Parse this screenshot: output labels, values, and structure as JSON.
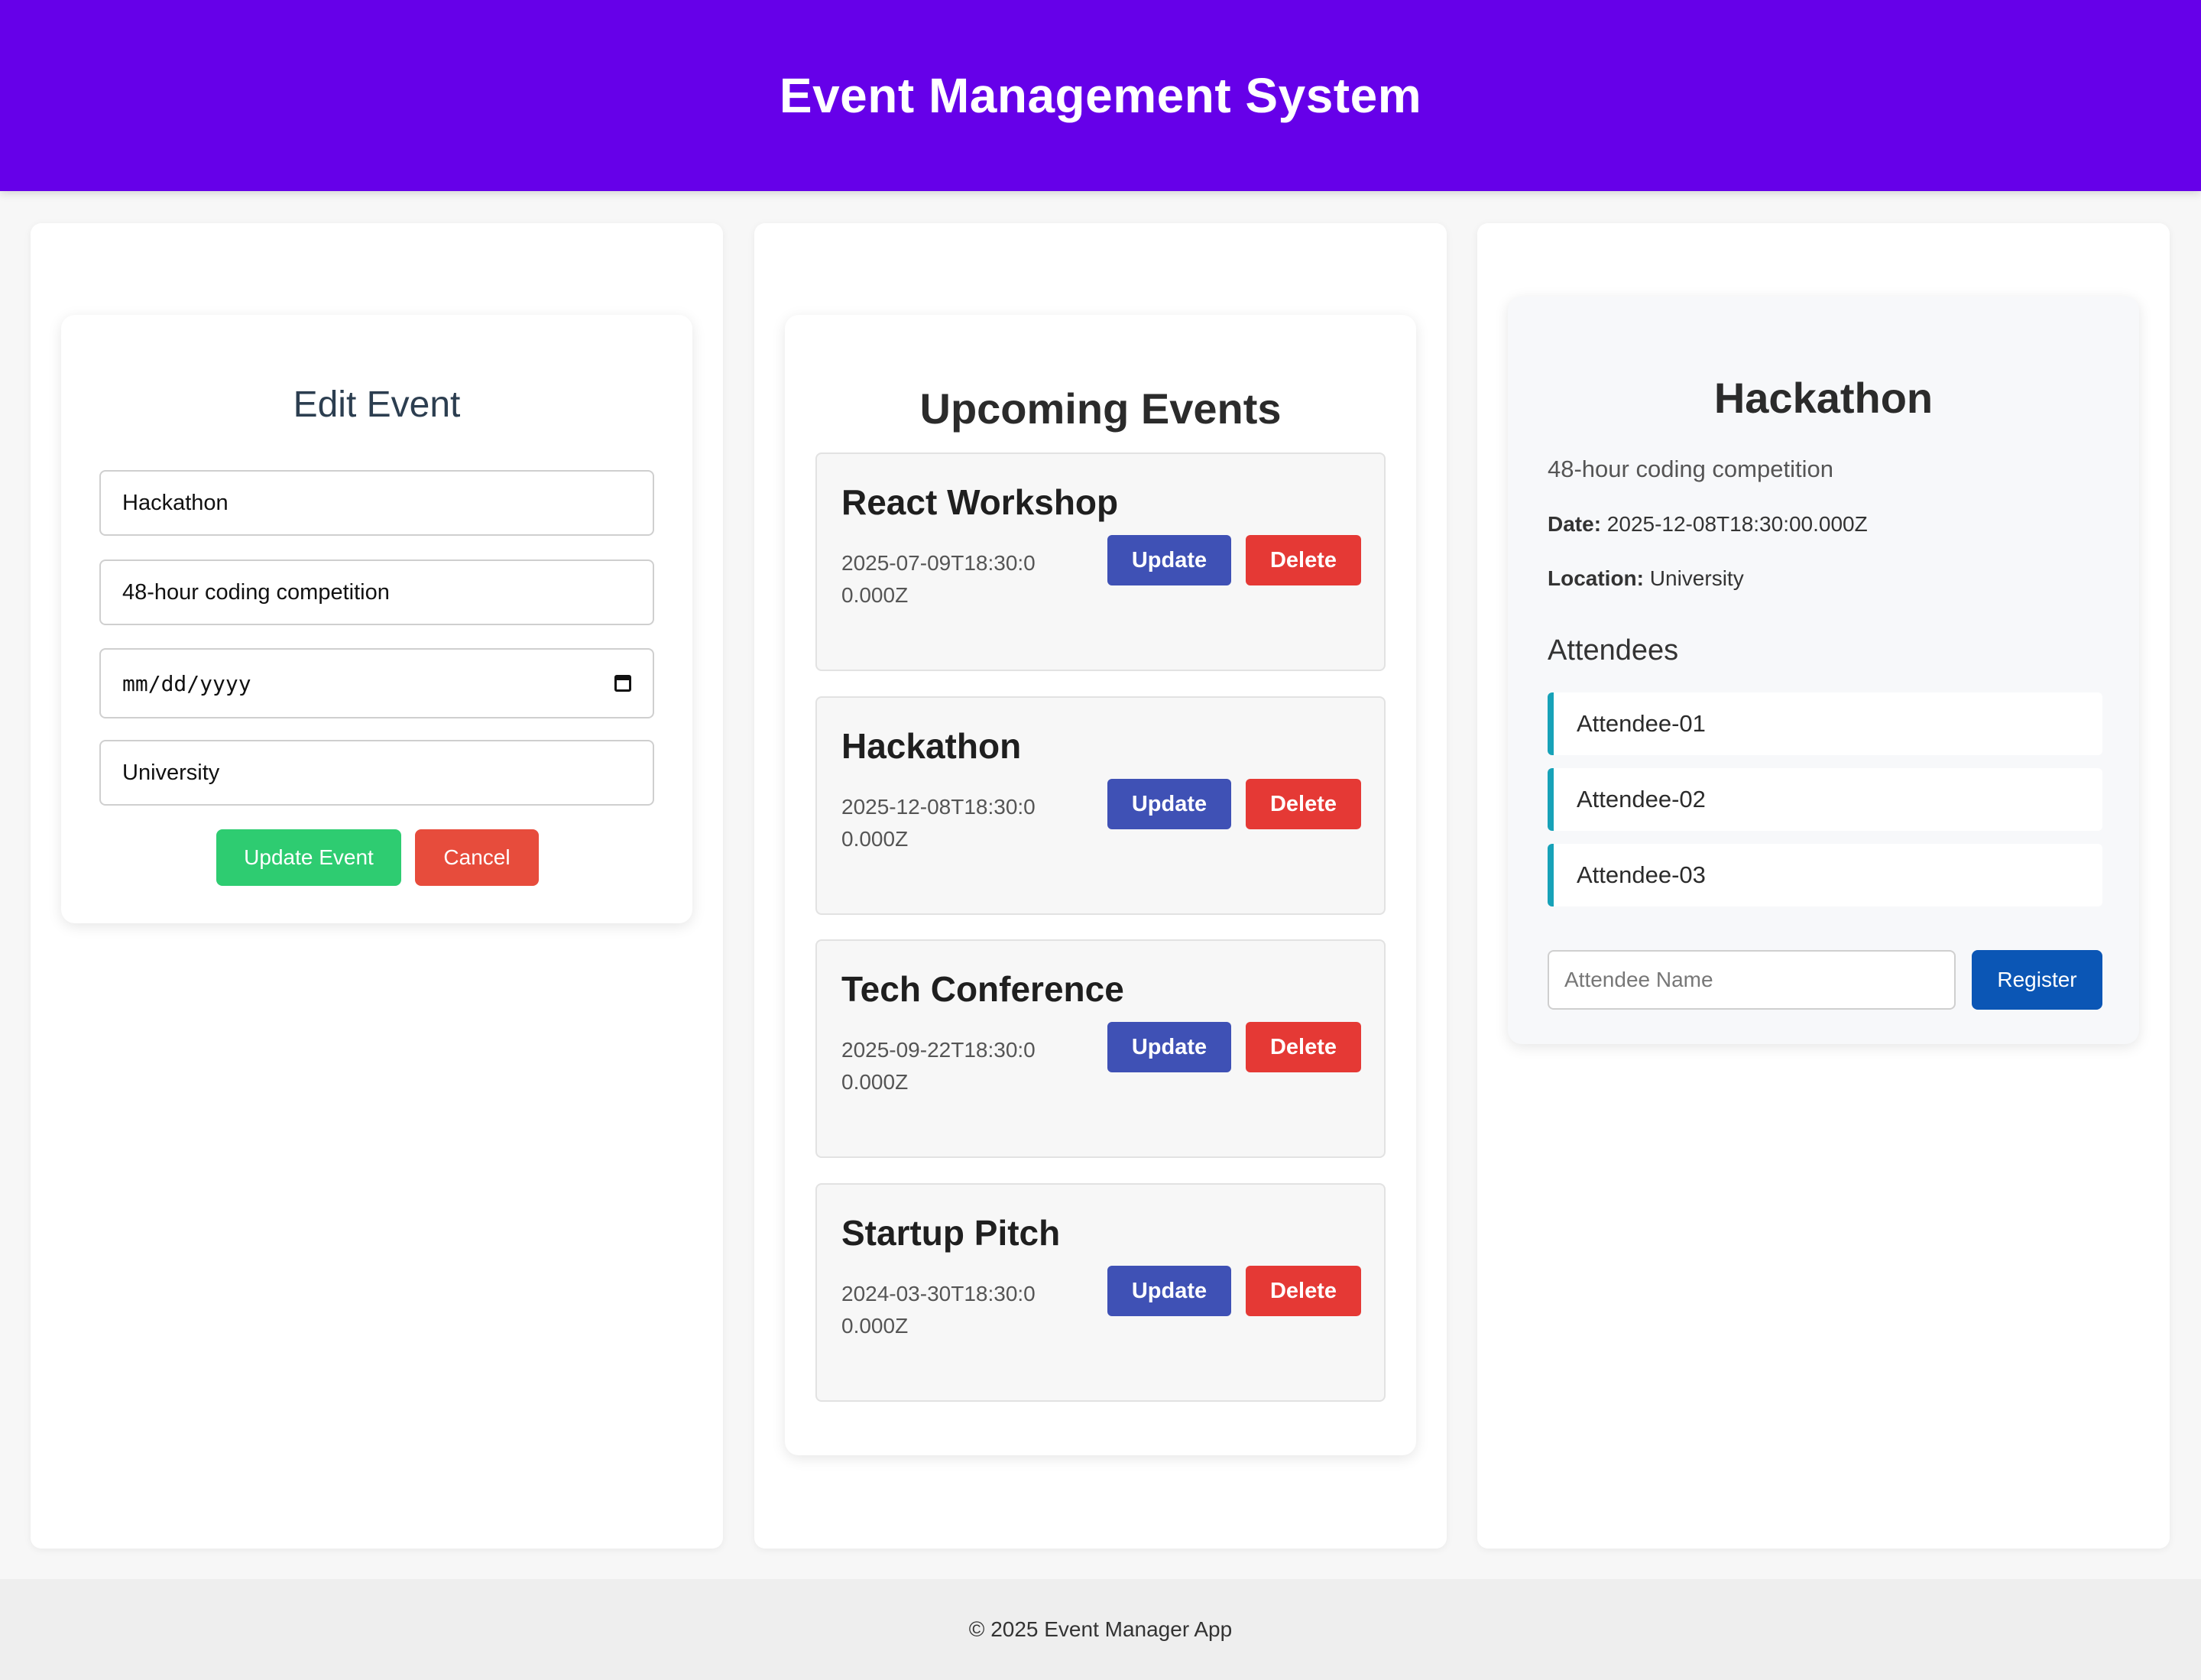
{
  "header": {
    "title": "Event Management System"
  },
  "edit_form": {
    "title": "Edit Event",
    "name_value": "Hackathon",
    "description_value": "48-hour coding competition",
    "date_placeholder": "mm/dd/yyyy",
    "location_value": "University",
    "update_label": "Update Event",
    "cancel_label": "Cancel"
  },
  "events": {
    "title": "Upcoming Events",
    "items": [
      {
        "name": "React Workshop",
        "date": "2025-07-09T18:30:00.000Z",
        "update_label": "Update",
        "delete_label": "Delete"
      },
      {
        "name": "Hackathon",
        "date": "2025-12-08T18:30:00.000Z",
        "update_label": "Update",
        "delete_label": "Delete"
      },
      {
        "name": "Tech Conference",
        "date": "2025-09-22T18:30:00.000Z",
        "update_label": "Update",
        "delete_label": "Delete"
      },
      {
        "name": "Startup Pitch",
        "date": "2024-03-30T18:30:00.000Z",
        "update_label": "Update",
        "delete_label": "Delete"
      }
    ]
  },
  "detail": {
    "title": "Hackathon",
    "description": "48-hour coding competition",
    "date_label": "Date:",
    "date_value": "2025-12-08T18:30:00.000Z",
    "location_label": "Location:",
    "location_value": "University",
    "attendees_heading": "Attendees",
    "attendees": [
      "Attendee-01",
      "Attendee-02",
      "Attendee-03"
    ],
    "attendee_placeholder": "Attendee Name",
    "register_label": "Register"
  },
  "footer": {
    "text": "© 2025 Event Manager App"
  },
  "colors": {
    "header_bg": "#6600e9",
    "update_event_btn": "#2ecc71",
    "cancel_btn": "#e74c3c",
    "item_update_btn": "#3f51b5",
    "item_delete_btn": "#e53935",
    "attendee_accent": "#17a2b8",
    "register_btn": "#0b56b5"
  },
  "icons": {
    "date_field": "calendar-icon"
  }
}
